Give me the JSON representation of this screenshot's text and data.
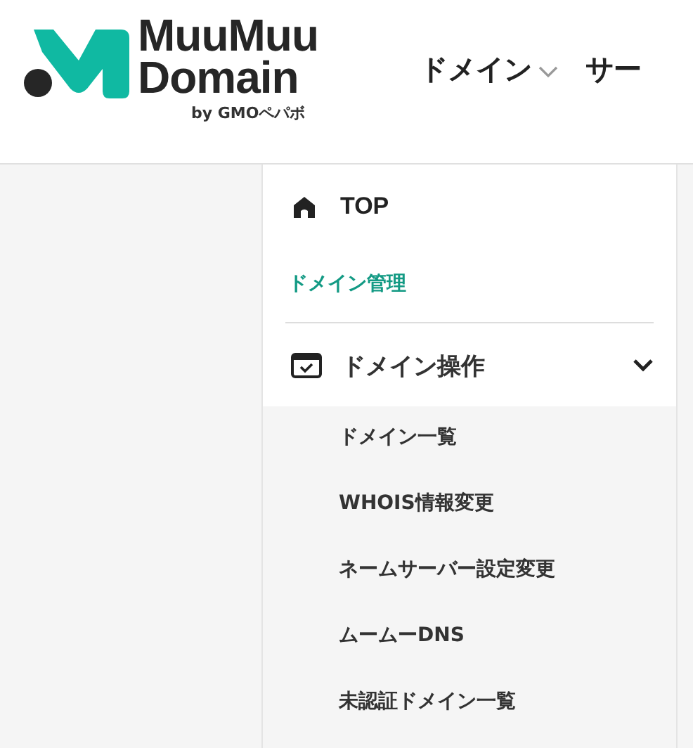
{
  "logo": {
    "line_1": "MuuMuu",
    "line_2": "Domain",
    "byline": "by GMOペパボ"
  },
  "nav": [
    {
      "label": "ドメイン",
      "has_dropdown": true
    },
    {
      "label": "サー",
      "has_dropdown": false
    }
  ],
  "sidebar": {
    "top": {
      "label": "TOP"
    },
    "section_title": "ドメイン管理",
    "group": {
      "label": "ドメイン操作",
      "expanded": true,
      "items": [
        {
          "label": "ドメイン一覧"
        },
        {
          "label": "WHOIS情報変更"
        },
        {
          "label": "ネームサーバー設定変更"
        },
        {
          "label": "ムームーDNS"
        },
        {
          "label": "未認証ドメイン一覧"
        }
      ]
    }
  }
}
